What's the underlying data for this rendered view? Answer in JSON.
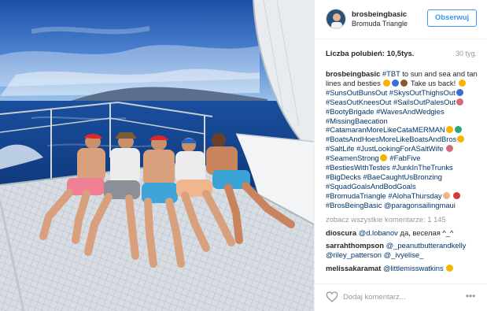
{
  "post": {
    "username": "brosbeingbasic",
    "location": "Bromuda Triangle",
    "follow_label": "Obserwuj",
    "likes_label": "Liczba polubień: 10,5tys.",
    "time_ago": "30 tyg.",
    "caption": {
      "author": "brosbeingbasic",
      "segments": [
        {
          "t": "tag",
          "v": "#TBT"
        },
        {
          "t": "text",
          "v": " to sun and sea and tan lines and besties "
        },
        {
          "t": "emoji",
          "v": "#f5b400"
        },
        {
          "t": "emoji",
          "v": "#3a6fd8"
        },
        {
          "t": "emoji",
          "v": "#8a5a2b"
        },
        {
          "t": "text",
          "v": " Take us back! "
        },
        {
          "t": "emoji",
          "v": "#f5b400"
        },
        {
          "t": "text",
          "v": " "
        },
        {
          "t": "tag",
          "v": "#SunsOutBunsOut"
        },
        {
          "t": "text",
          "v": " "
        },
        {
          "t": "tag",
          "v": "#SkysOutThighsOut"
        },
        {
          "t": "emoji",
          "v": "#3a6fd8"
        },
        {
          "t": "text",
          "v": " "
        },
        {
          "t": "tag",
          "v": "#SeasOutKneesOut"
        },
        {
          "t": "text",
          "v": " "
        },
        {
          "t": "tag",
          "v": "#SailsOutPalesOut"
        },
        {
          "t": "emoji",
          "v": "#d46a7e"
        },
        {
          "t": "text",
          "v": " "
        },
        {
          "t": "tag",
          "v": "#BootyBrigade"
        },
        {
          "t": "text",
          "v": " "
        },
        {
          "t": "tag",
          "v": "#WavesAndWedgies"
        },
        {
          "t": "text",
          "v": " "
        },
        {
          "t": "tag",
          "v": "#MissingBaecation"
        },
        {
          "t": "text",
          "v": " "
        },
        {
          "t": "tag",
          "v": "#CatamaranMoreLikeCataMERMAN"
        },
        {
          "t": "emoji",
          "v": "#f5b400"
        },
        {
          "t": "emoji",
          "v": "#2fa37a"
        },
        {
          "t": "text",
          "v": " "
        },
        {
          "t": "tag",
          "v": "#BoatsAndHoesMoreLikeBoatsAndBros"
        },
        {
          "t": "emoji",
          "v": "#f5b400"
        },
        {
          "t": "text",
          "v": " "
        },
        {
          "t": "tag",
          "v": "#SaltLife"
        },
        {
          "t": "text",
          "v": " "
        },
        {
          "t": "tag",
          "v": "#JustLookingForASaltWife"
        },
        {
          "t": "text",
          "v": " "
        },
        {
          "t": "emoji",
          "v": "#d46a7e"
        },
        {
          "t": "text",
          "v": " "
        },
        {
          "t": "tag",
          "v": "#SeamenStrong"
        },
        {
          "t": "emoji",
          "v": "#f5b400"
        },
        {
          "t": "text",
          "v": " "
        },
        {
          "t": "tag",
          "v": "#FabFive"
        },
        {
          "t": "text",
          "v": " "
        },
        {
          "t": "tag",
          "v": "#BestiesWithTestes"
        },
        {
          "t": "text",
          "v": " "
        },
        {
          "t": "tag",
          "v": "#JunkInTheTrunks"
        },
        {
          "t": "text",
          "v": " "
        },
        {
          "t": "tag",
          "v": "#BigDecks"
        },
        {
          "t": "text",
          "v": " "
        },
        {
          "t": "tag",
          "v": "#BaeCaughtUsBronzing"
        },
        {
          "t": "text",
          "v": " "
        },
        {
          "t": "tag",
          "v": "#SquadGoalsAndBodGoals"
        },
        {
          "t": "text",
          "v": " "
        },
        {
          "t": "tag",
          "v": "#BromudaTriangle"
        },
        {
          "t": "text",
          "v": " "
        },
        {
          "t": "tag",
          "v": "#AlohaThursday"
        },
        {
          "t": "emoji",
          "v": "#e8b98a"
        },
        {
          "t": "text",
          "v": " "
        },
        {
          "t": "emoji",
          "v": "#d33b3b"
        },
        {
          "t": "text",
          "v": " "
        },
        {
          "t": "tag",
          "v": "#BrosBeingBasic"
        },
        {
          "t": "text",
          "v": " "
        },
        {
          "t": "tag",
          "v": "@paragonsailingmaui"
        }
      ]
    },
    "view_all_label": "zobacz wszystkie komentarze: 1 145",
    "comments": [
      {
        "user": "dioscura",
        "segments": [
          {
            "t": "tag",
            "v": "@d.lobanov"
          },
          {
            "t": "text",
            "v": " да, веселая ^_^"
          }
        ]
      },
      {
        "user": "sarrahthompson",
        "segments": [
          {
            "t": "tag",
            "v": "@_peanutbutterandkelly"
          },
          {
            "t": "text",
            "v": " "
          },
          {
            "t": "tag",
            "v": "@riley_patterson"
          },
          {
            "t": "text",
            "v": " "
          },
          {
            "t": "tag",
            "v": "@_ivyelise_"
          }
        ]
      },
      {
        "user": "melissakaramat",
        "segments": [
          {
            "t": "tag",
            "v": "@littlemisswatkins"
          },
          {
            "t": "text",
            "v": " "
          },
          {
            "t": "emoji",
            "v": "#f5b400"
          }
        ]
      }
    ],
    "comment_placeholder": "Dodaj komentarz...",
    "icons": {
      "like": "heart-icon",
      "more": "more-options-icon"
    },
    "colors": {
      "accent": "#3897f0",
      "hashtag": "#003569",
      "muted": "#999999"
    }
  }
}
